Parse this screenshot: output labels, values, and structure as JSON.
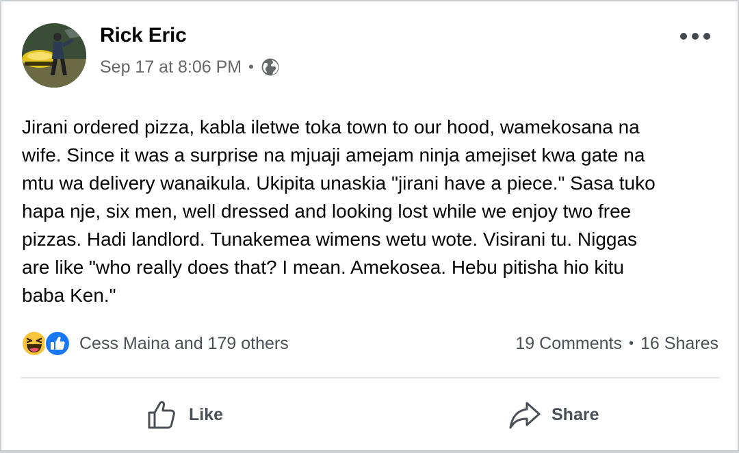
{
  "post": {
    "author": "Rick Eric",
    "timestamp": "Sep 17 at 8:06 PM",
    "separator": "•",
    "privacy_icon": "globe-icon",
    "text": "Jirani ordered pizza, kabla iletwe toka town to our hood, wamekosana na\nwife. Since it was a surprise na mjuaji amejam ninja amejiset kwa gate na\nmtu wa delivery wanaikula. Ukipita unaskia \"jirani have a piece.\" Sasa tuko\nhapa nje, six men, well dressed and looking lost while we enjoy two free\npizzas. Hadi landlord. Tunakemea wimens wetu wote. Visirani tu. Niggas\nare like \"who really does that? I mean. Amekosea. Hebu pitisha hio kitu\nbaba Ken.\""
  },
  "reactions": {
    "icons": [
      "haha-icon",
      "like-reaction-icon"
    ],
    "summary": "Cess Maina and 179 others",
    "comments": "19 Comments",
    "shares": "16 Shares",
    "separator": "•"
  },
  "actions": {
    "like_label": "Like",
    "share_label": "Share"
  },
  "colors": {
    "like_blue": "#1877f2",
    "haha_yellow": "#f7c53c",
    "text_primary": "#050505",
    "text_secondary": "#65676b"
  }
}
